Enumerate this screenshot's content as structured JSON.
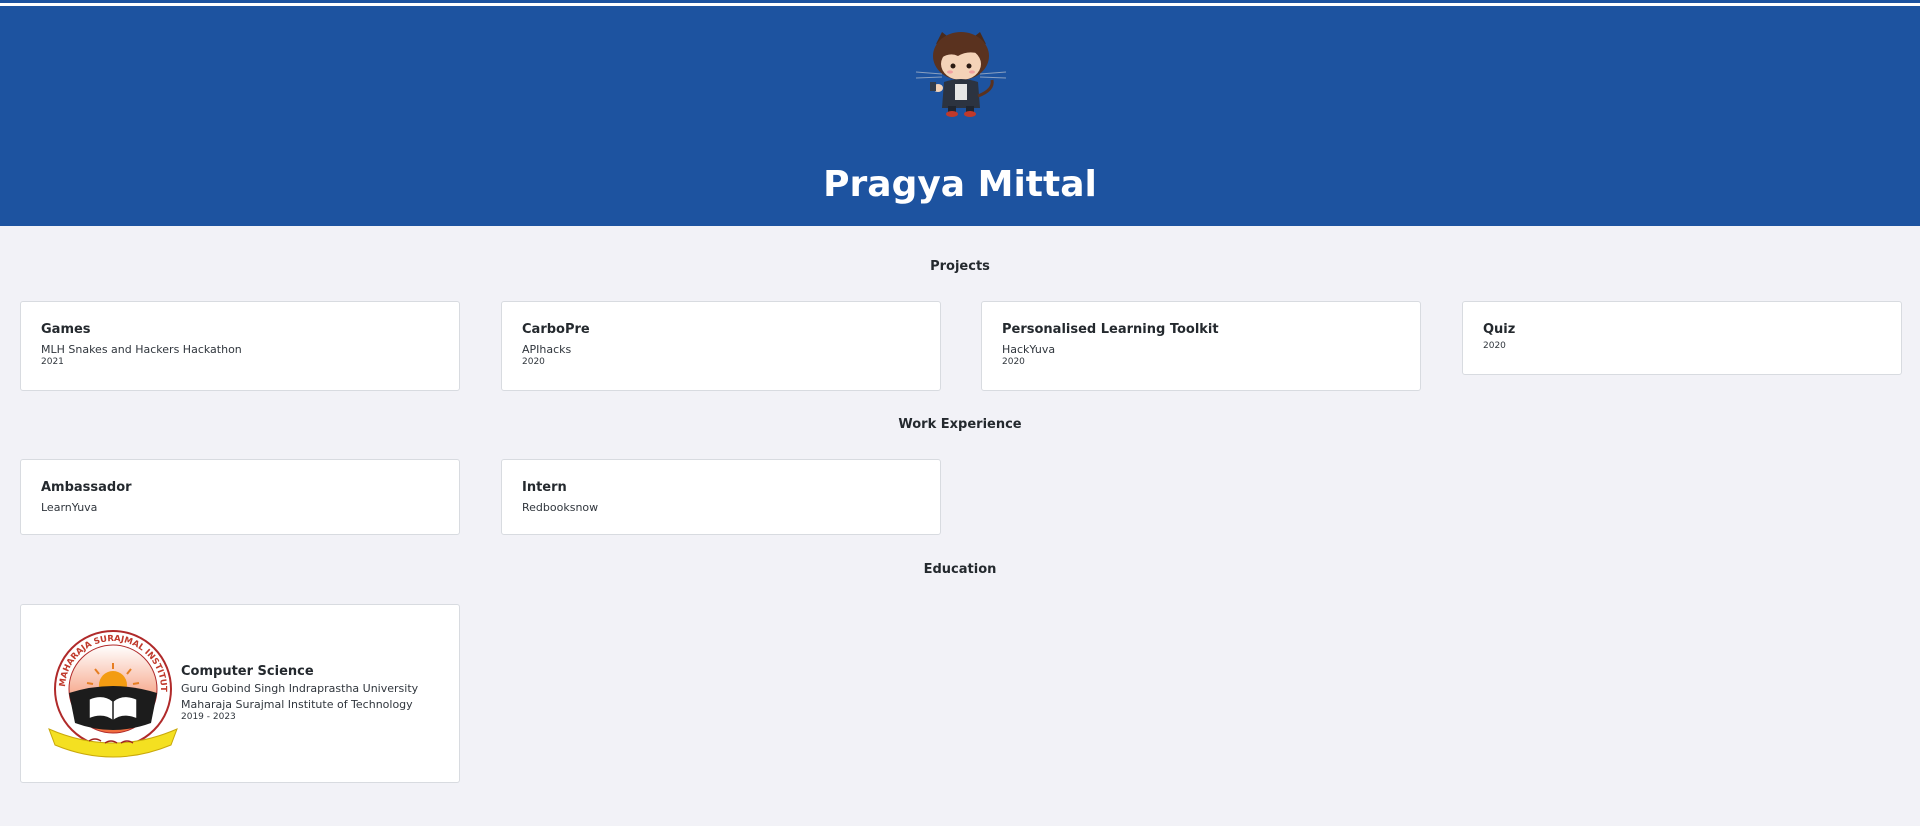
{
  "header": {
    "name": "Pragya Mittal",
    "avatar_icon": "octocat-avatar-icon",
    "background_color": "#1d53a0"
  },
  "projects": {
    "heading": "Projects",
    "items": [
      {
        "title": "Games",
        "event": "MLH Snakes and Hackers Hackathon",
        "year": "2021"
      },
      {
        "title": "CarboPre",
        "event": "APIhacks",
        "year": "2020"
      },
      {
        "title": "Personalised Learning Toolkit",
        "event": "HackYuva",
        "year": "2020"
      },
      {
        "title": "Quiz",
        "year": "2020"
      }
    ]
  },
  "work": {
    "heading": "Work Experience",
    "items": [
      {
        "title": "Ambassador",
        "company": "LearnYuva"
      },
      {
        "title": "Intern",
        "company": "Redbooksnow"
      }
    ]
  },
  "education": {
    "heading": "Education",
    "items": [
      {
        "degree": "Computer Science",
        "university": "Guru Gobind Singh Indraprastha University",
        "institute": "Maharaja Surajmal Institute of Technology",
        "years": "2019 - 2023",
        "logo_icon": "msit-logo-icon",
        "logo_text": "MAHARAJA SURAJMAL INSTITUTE OF TECHNOLOGY"
      }
    ]
  }
}
